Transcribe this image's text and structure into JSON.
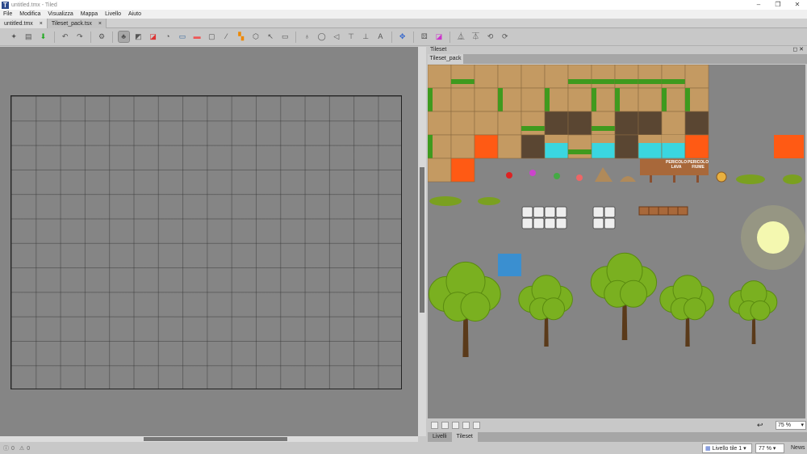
{
  "window": {
    "title": "untitled.tmx - Tiled",
    "logo": "T"
  },
  "menu": [
    "File",
    "Modifica",
    "Visualizza",
    "Mappa",
    "Livello",
    "Aiuto"
  ],
  "tabs": [
    {
      "label": "untitled.tmx",
      "close": "×"
    },
    {
      "label": "Tileset_pack.tsx",
      "close": "×"
    }
  ],
  "toolbar": [
    "new",
    "open",
    "save",
    "undo",
    "redo",
    "commands",
    "stamp-brush",
    "terrain-brush",
    "wang-brush",
    "bucket-fill",
    "shape-fill",
    "eraser",
    "rect-select",
    "magic-wand",
    "select-same",
    "edit-polygons",
    "select-objects",
    "insert-rect",
    "insert-point",
    "insert-ellipse",
    "insert-polygon",
    "insert-tile",
    "insert-template",
    "insert-text",
    "move",
    "random",
    "wang",
    "flip-h",
    "flip-v",
    "rotate-left",
    "rotate-right"
  ],
  "tileset_panel": {
    "title": "Tileset",
    "tab": "Tileset_pack",
    "zoom": "75 %",
    "sign_lava": "PERICOLO LAVA",
    "sign_river": "PERICOLO FIUME"
  },
  "dock_tabs": [
    "Livelli",
    "Tileset"
  ],
  "status": {
    "errors": "0",
    "warnings": "0",
    "layer": "Livello tile 1",
    "zoom": "77 %",
    "news": "News"
  },
  "colors": {
    "grass": "#3f9a1e",
    "dirt": "#c49a62",
    "water": "#3ad6e0",
    "lava": "#ff5a14",
    "rock": "#5a4632"
  }
}
